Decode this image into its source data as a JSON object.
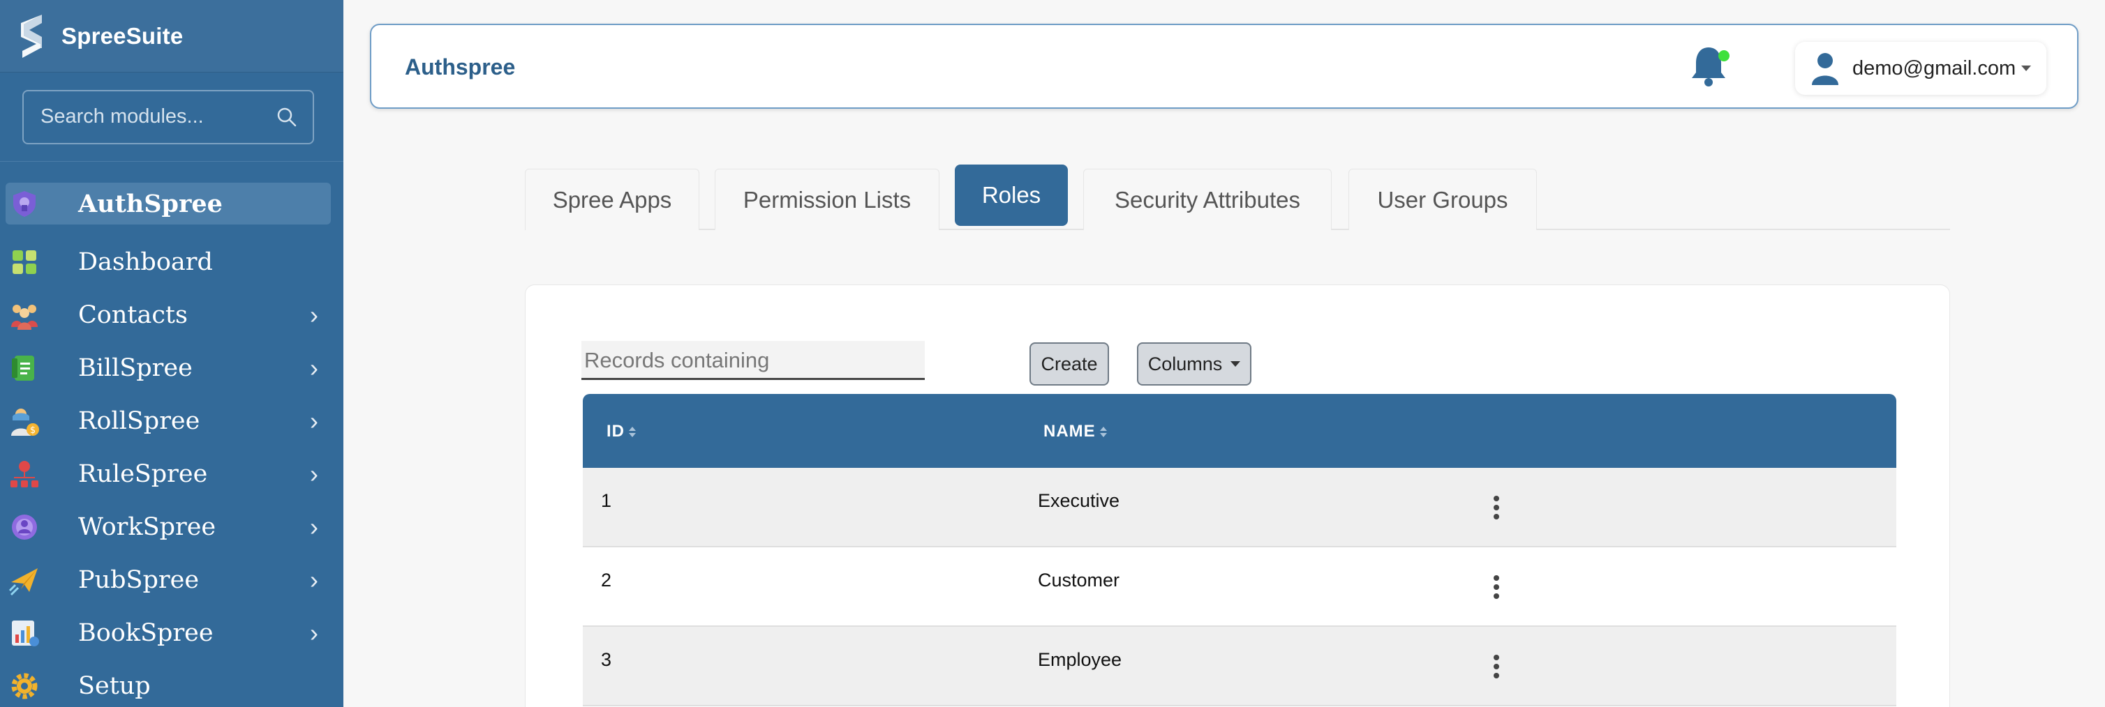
{
  "sidebar": {
    "brand": "SpreeSuite",
    "search_placeholder": "Search modules...",
    "items": [
      {
        "label": "AuthSpree",
        "icon": "authspree-icon",
        "active": true,
        "expandable": false
      },
      {
        "label": "Dashboard",
        "icon": "dashboard-icon",
        "active": false,
        "expandable": false
      },
      {
        "label": "Contacts",
        "icon": "contacts-icon",
        "active": false,
        "expandable": true
      },
      {
        "label": "BillSpree",
        "icon": "billspree-icon",
        "active": false,
        "expandable": true
      },
      {
        "label": "RollSpree",
        "icon": "rollspree-icon",
        "active": false,
        "expandable": true
      },
      {
        "label": "RuleSpree",
        "icon": "rulespree-icon",
        "active": false,
        "expandable": true
      },
      {
        "label": "WorkSpree",
        "icon": "workspree-icon",
        "active": false,
        "expandable": true
      },
      {
        "label": "PubSpree",
        "icon": "pubspree-icon",
        "active": false,
        "expandable": true
      },
      {
        "label": "BookSpree",
        "icon": "bookspree-icon",
        "active": false,
        "expandable": true
      },
      {
        "label": "Setup",
        "icon": "gear-icon",
        "active": false,
        "expandable": false
      }
    ]
  },
  "header": {
    "title": "Authspree",
    "user_email": "demo@gmail.com",
    "notification_dot_color": "#3ee03b"
  },
  "tabs": [
    {
      "label": "Spree Apps",
      "active": false
    },
    {
      "label": "Permission Lists",
      "active": false
    },
    {
      "label": "Roles",
      "active": true
    },
    {
      "label": "Security Attributes",
      "active": false
    },
    {
      "label": "User Groups",
      "active": false
    }
  ],
  "toolbar": {
    "filter_placeholder": "Records containing",
    "filter_value": "",
    "create_label": "Create",
    "columns_label": "Columns"
  },
  "table": {
    "columns": [
      "ID",
      "NAME"
    ],
    "rows": [
      {
        "id": "1",
        "name": "Executive"
      },
      {
        "id": "2",
        "name": "Customer"
      },
      {
        "id": "3",
        "name": "Employee"
      }
    ]
  },
  "colors": {
    "sidebar": "#336a99",
    "accent": "#336a99",
    "header_title": "#2c5f8a"
  }
}
